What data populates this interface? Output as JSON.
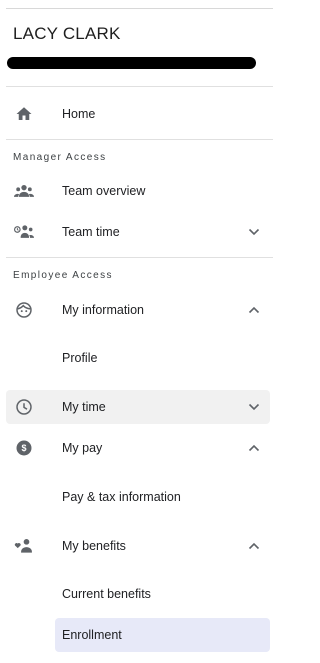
{
  "user": {
    "name": "LACY CLARK"
  },
  "nav": {
    "home": {
      "label": "Home",
      "icon": "home-icon"
    },
    "manager_section": "Manager Access",
    "team_overview": {
      "label": "Team overview",
      "icon": "group-icon"
    },
    "team_time": {
      "label": "Team time",
      "icon": "group-time-icon",
      "expanded": false
    },
    "employee_section": "Employee Access",
    "my_information": {
      "label": "My information",
      "icon": "face-icon",
      "expanded": true,
      "children": [
        "Profile"
      ]
    },
    "my_time": {
      "label": "My time",
      "icon": "clock-icon",
      "expanded": false
    },
    "my_pay": {
      "label": "My pay",
      "icon": "dollar-circle-icon",
      "expanded": true,
      "children": [
        "Pay & tax information"
      ]
    },
    "my_benefits": {
      "label": "My benefits",
      "icon": "benefits-icon",
      "expanded": true,
      "children": [
        "Current benefits",
        "Enrollment"
      ]
    }
  },
  "selected": "Enrollment",
  "colors": {
    "icon": "#5f6368",
    "selected_bg": "#e7e9f8",
    "hover_bg": "#f1f1f1",
    "divider": "#e0e0e0"
  }
}
